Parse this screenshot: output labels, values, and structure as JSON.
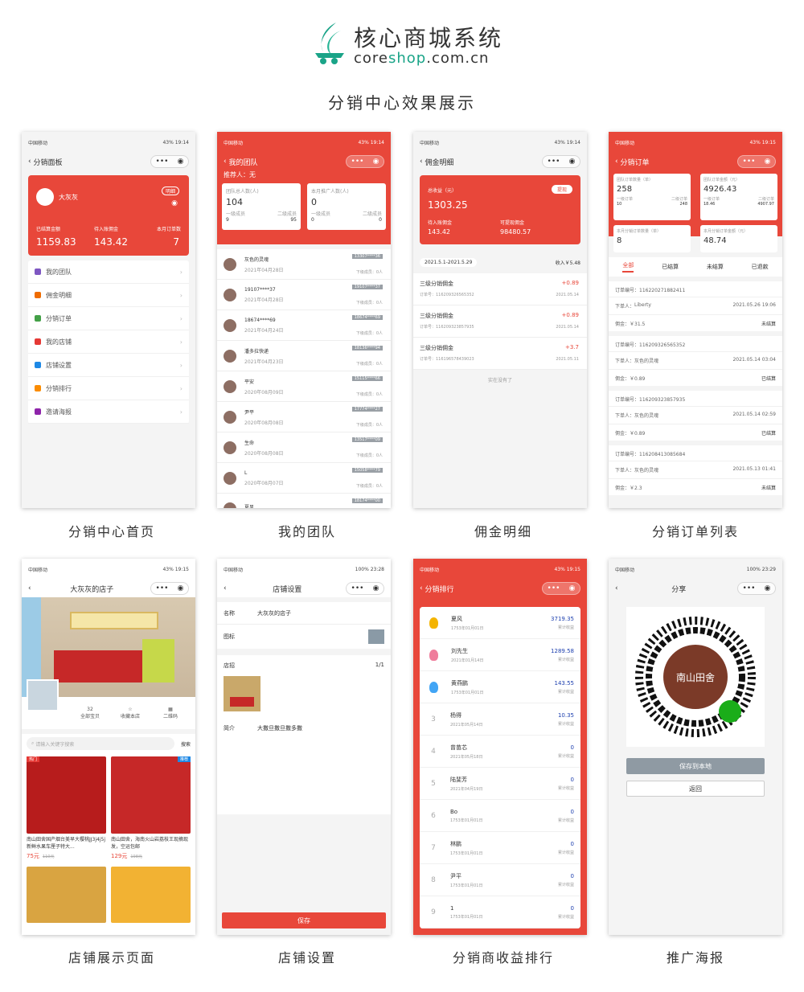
{
  "header": {
    "brand": "核心商城系统",
    "url_a": "core",
    "url_b": "shop",
    "url_c": ".com.cn",
    "subtitle": "分销中心效果展示"
  },
  "captions": [
    "分销中心首页",
    "我的团队",
    "佣金明细",
    "分销订单列表",
    "店铺展示页面",
    "店铺设置",
    "分销商收益排行",
    "推广海报"
  ],
  "status": {
    "carrier": "中国移动",
    "battery1": "43%",
    "time1": "19:14",
    "time2": "19:15",
    "battery2": "100%",
    "time3": "23:28",
    "time4": "23:29"
  },
  "s1": {
    "title": "分销面板",
    "name": "大灰灰",
    "tag": "明细",
    "l1": "已结算金额",
    "l2": "待入账佣金",
    "l3": "本月订单数",
    "v1": "1159.83",
    "v2": "143.42",
    "v3": "7",
    "menu": [
      "我的团队",
      "佣金明细",
      "分销订单",
      "我的店铺",
      "店铺设置",
      "分销排行",
      "邀请海报"
    ],
    "menu_colors": [
      "#7e57c2",
      "#ef6c00",
      "#43a047",
      "#e53935",
      "#1e88e5",
      "#fb8c00",
      "#8e24aa"
    ]
  },
  "s2": {
    "title": "我的团队",
    "ref": "推荐人：无",
    "c1": "团队总人数(人)",
    "c2": "本月推广人数(人)",
    "v1": "104",
    "v2": "0",
    "sub1": "一级成员",
    "sub2": "二级成员",
    "s1v": "9",
    "s2v": "95",
    "s3v": "0",
    "s4v": "0",
    "members": [
      {
        "n": "灰色的灵魂",
        "d": "2021年04月28日",
        "p": "13307****36"
      },
      {
        "n": "19107****37",
        "d": "2021年04月28日",
        "p": "19107****37"
      },
      {
        "n": "18674****69",
        "d": "2021年04月24日",
        "p": "18674****69"
      },
      {
        "n": "潘多拉快递",
        "d": "2021年04月23日",
        "p": "18136****94"
      },
      {
        "n": "平安",
        "d": "2020年08月09日",
        "p": "15115****66"
      },
      {
        "n": "尹平",
        "d": "2020年08月08日",
        "p": "17774****27"
      },
      {
        "n": "生命",
        "d": "2020年08月08日",
        "p": "13517****09"
      },
      {
        "n": "L",
        "d": "2020年08月07日",
        "p": "15058****79"
      },
      {
        "n": "夏风",
        "d": "",
        "p": "18174****00"
      }
    ],
    "down": "下级成员：0人"
  },
  "s3": {
    "title": "佣金明细",
    "total_label": "总收益（元）",
    "total": "1303.25",
    "btn": "提现",
    "l1": "待入账佣金",
    "l2": "可提现佣金",
    "v1": "143.42",
    "v2": "98480.57",
    "range": "2021.5.1-2021.5.29",
    "income": "收入￥5.48",
    "items": [
      {
        "t": "三级分销佣金",
        "o": "订单号：116209326565352",
        "a": "+0.89",
        "d": "2021.05.14"
      },
      {
        "t": "三级分销佣金",
        "o": "订单号：116209323857935",
        "a": "+0.89",
        "d": "2021.05.14"
      },
      {
        "t": "三级分销佣金",
        "o": "订单号：116196578439023",
        "a": "+3.7",
        "d": "2021.05.11"
      }
    ],
    "empty": "实在没有了"
  },
  "s4": {
    "title": "分销订单",
    "k1": "团队订单数量（单）",
    "v1": "258",
    "k2": "团队订单金额（元）",
    "v2": "4926.43",
    "a1": "一级订单",
    "a1v": "10",
    "a2": "二级订单",
    "a2v": "248",
    "b1": "一级订单",
    "b1v": "18.46",
    "b2": "二级订单",
    "b2v": "4907.97",
    "k3": "本月分销订单数量（单）",
    "v3": "8",
    "k4": "本月分销订单金额（元）",
    "v4": "48.74",
    "tabs": [
      "全部",
      "已结算",
      "未结算",
      "已退款"
    ],
    "orders": [
      {
        "no": "订单编号：116220271882411",
        "u": "Liberty",
        "d": "2021.05.26 19:06",
        "m": "佣金：￥31.5",
        "s": "未结算"
      },
      {
        "no": "订单编号：116209326565352",
        "u": "灰色的灵魂",
        "d": "2021.05.14 03:04",
        "m": "佣金：￥0.89",
        "s": "已结算"
      },
      {
        "no": "订单编号：116209323857935",
        "u": "灰色的灵魂",
        "d": "2021.05.14 02:59",
        "m": "佣金：￥0.89",
        "s": "已结算"
      },
      {
        "no": "订单编号：116208413085684",
        "u": "灰色的灵魂",
        "d": "2021.05.13 01:41",
        "m": "佣金：￥2.3",
        "s": "未结算"
      }
    ],
    "buyer": "下单人："
  },
  "s5": {
    "title": "大灰灰的店子",
    "count": "32",
    "all": "全部宝贝",
    "fav": "收藏本店",
    "qr": "二维码",
    "search": "请输入关键字搜索",
    "search_btn": "搜索",
    "goods": [
      {
        "name": "南山田舍国产烟台美早大樱桃JJ3j4j5j新鲜水果车厘子特大...",
        "price": "75元",
        "old": "110元",
        "tag": "热门"
      },
      {
        "name": "南山田舍，海南火山岩荔枝王现摘现发，空运包邮",
        "price": "129元",
        "old": "198元",
        "tag": "推荐"
      }
    ]
  },
  "s6": {
    "title": "店铺设置",
    "k1": "名称",
    "v1": "大灰灰的店子",
    "k2": "图标",
    "k3": "店招",
    "pg": "1/1",
    "k4": "简介",
    "v4": "大撒旦撒旦撒多撒",
    "save": "保存"
  },
  "s7": {
    "title": "分销排行",
    "earn": "累计收益",
    "rows": [
      {
        "r": "1",
        "n": "夏风",
        "d": "1753年01月01日",
        "v": "3719.35"
      },
      {
        "r": "2",
        "n": "刘先生",
        "d": "2021年01月14日",
        "v": "1289.58"
      },
      {
        "r": "3",
        "n": "黄燕鹏",
        "d": "1753年01月01日",
        "v": "143.55"
      },
      {
        "r": "3",
        "n": "杨得",
        "d": "2021年05月14日",
        "v": "10.35"
      },
      {
        "r": "4",
        "n": "曾苗芯",
        "d": "2021年05月18日",
        "v": "0"
      },
      {
        "r": "5",
        "n": "陆斐芳",
        "d": "2021年04月19日",
        "v": "0"
      },
      {
        "r": "6",
        "n": "Bo",
        "d": "1753年01月01日",
        "v": "0"
      },
      {
        "r": "7",
        "n": "林鹏",
        "d": "1753年01月01日",
        "v": "0"
      },
      {
        "r": "8",
        "n": "尹平",
        "d": "1753年01月01日",
        "v": "0"
      },
      {
        "r": "9",
        "n": "1",
        "d": "1753年01月01日",
        "v": "0"
      }
    ]
  },
  "s8": {
    "title": "分享",
    "logo": "南山田舍",
    "save": "保存到本地",
    "back": "返回"
  }
}
